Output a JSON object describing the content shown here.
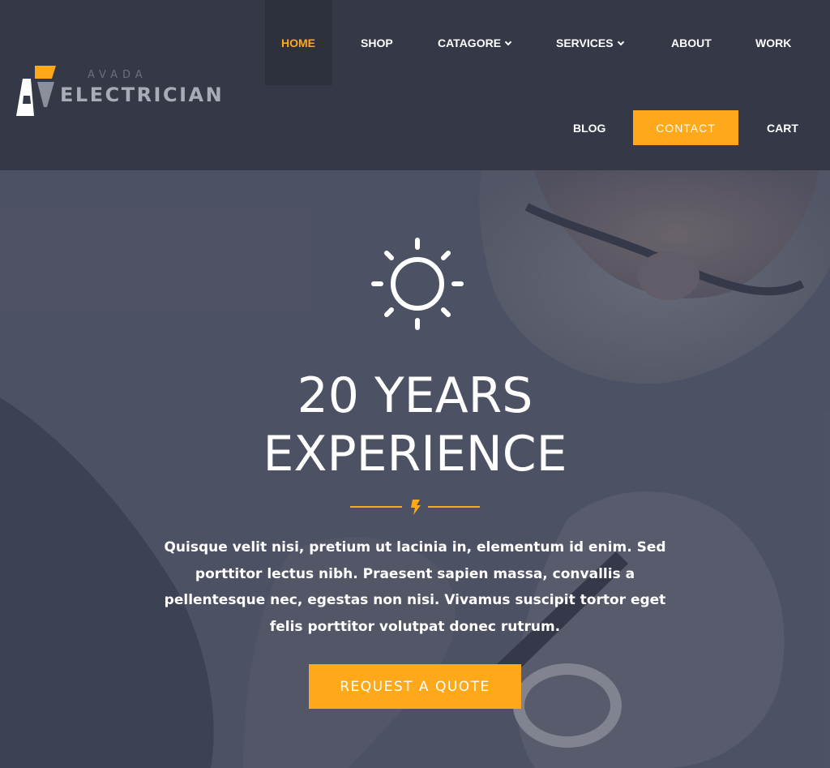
{
  "brand": {
    "small_text": "AVADA",
    "big_text": "ELECTRICIAN",
    "accent_color": "#ffa81a",
    "header_bg": "#353847"
  },
  "nav": {
    "items": [
      {
        "label": "HOME",
        "active": true
      },
      {
        "label": "SHOP"
      },
      {
        "label": "CATAGORE",
        "dropdown": true
      },
      {
        "label": "SERVICES",
        "dropdown": true
      },
      {
        "label": "ABOUT"
      },
      {
        "label": "WORK"
      },
      {
        "label": "BLOG"
      },
      {
        "label": "CONTACT",
        "button": true
      },
      {
        "label": "CART"
      }
    ]
  },
  "hero": {
    "icon": "sun-icon",
    "title_line1": "20 YEARS",
    "title_line2": "EXPERIENCE",
    "divider_icon": "lightning-icon",
    "text": "Quisque velit nisi, pretium ut lacinia in, elementum id enim. Sed porttitor lectus nibh. Praesent sapien massa, convallis a pellentesque nec, egestas non nisi. Vivamus suscipit tortor eget felis porttitor volutpat donec rutrum.",
    "cta_label": "REQUEST A QUOTE"
  }
}
